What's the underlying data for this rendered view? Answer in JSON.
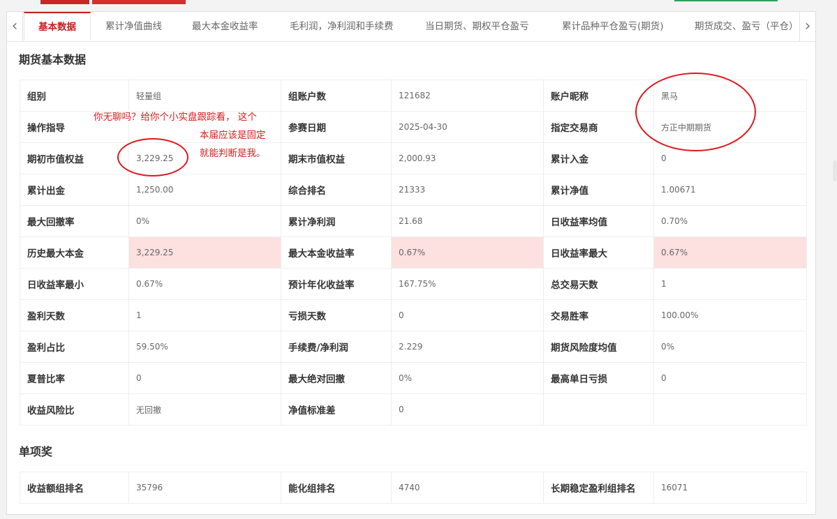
{
  "tabs": [
    {
      "label": "基本数据",
      "active": true
    },
    {
      "label": "累计净值曲线"
    },
    {
      "label": "最大本金收益率"
    },
    {
      "label": "毛利润，净利润和手续费"
    },
    {
      "label": "当日期货、期权平仓盈亏"
    },
    {
      "label": "累计品种平仓盈亏(期货)"
    },
    {
      "label": "期货成交、盈亏（平仓）"
    }
  ],
  "nav": {
    "prev": "‹",
    "next": "›"
  },
  "basic": {
    "title": "期货基本数据",
    "rows": [
      [
        {
          "label": "组别",
          "value": "轻量组"
        },
        {
          "label": "组账户数",
          "value": "121682"
        },
        {
          "label": "账户昵称",
          "value": "黑马"
        }
      ],
      [
        {
          "label": "操作指导",
          "value": ""
        },
        {
          "label": "参赛日期",
          "value": "2025-04-30"
        },
        {
          "label": "指定交易商",
          "value": "方正中期期货"
        }
      ],
      [
        {
          "label": "期初市值权益",
          "value": "3,229.25"
        },
        {
          "label": "期末市值权益",
          "value": "2,000.93"
        },
        {
          "label": "累计入金",
          "value": "0"
        }
      ],
      [
        {
          "label": "累计出金",
          "value": "1,250.00"
        },
        {
          "label": "综合排名",
          "value": "21333"
        },
        {
          "label": "累计净值",
          "value": "1.00671"
        }
      ],
      [
        {
          "label": "最大回撤率",
          "value": "0%"
        },
        {
          "label": "累计净利润",
          "value": "21.68"
        },
        {
          "label": "日收益率均值",
          "value": "0.70%"
        }
      ],
      [
        {
          "label": "历史最大本金",
          "value": "3,229.25"
        },
        {
          "label": "最大本金收益率",
          "value": "0.67%"
        },
        {
          "label": "日收益率最大",
          "value": "0.67%"
        }
      ],
      [
        {
          "label": "日收益率最小",
          "value": "0.67%"
        },
        {
          "label": "预计年化收益率",
          "value": "167.75%"
        },
        {
          "label": "总交易天数",
          "value": "1"
        }
      ],
      [
        {
          "label": "盈利天数",
          "value": "1"
        },
        {
          "label": "亏损天数",
          "value": "0"
        },
        {
          "label": "交易胜率",
          "value": "100.00%"
        }
      ],
      [
        {
          "label": "盈利占比",
          "value": "59.50%"
        },
        {
          "label": "手续费/净利润",
          "value": "2.229"
        },
        {
          "label": "期货风险度均值",
          "value": "0%"
        }
      ],
      [
        {
          "label": "夏普比率",
          "value": "0"
        },
        {
          "label": "最大绝对回撤",
          "value": "0%"
        },
        {
          "label": "最高单日亏损",
          "value": "0"
        }
      ],
      [
        {
          "label": "收益风险比",
          "value": "无回撤"
        },
        {
          "label": "净值标准差",
          "value": "0"
        },
        {
          "label": "",
          "value": ""
        }
      ]
    ]
  },
  "awards": {
    "title": "单项奖",
    "rows": [
      [
        {
          "label": "收益额组排名",
          "value": "35796"
        },
        {
          "label": "能化组排名",
          "value": "4740"
        },
        {
          "label": "长期稳定盈利组排名",
          "value": "16071"
        }
      ]
    ]
  },
  "annotation": {
    "lines": [
      "你无聊吗？给你个小实盘跟踪看，  这个",
      "本届应该是固定",
      "就能判断是我。"
    ],
    "color": "#e0161c"
  },
  "colors": {
    "accent": "#c81e1e",
    "highlight_row": "#fde0e0"
  }
}
